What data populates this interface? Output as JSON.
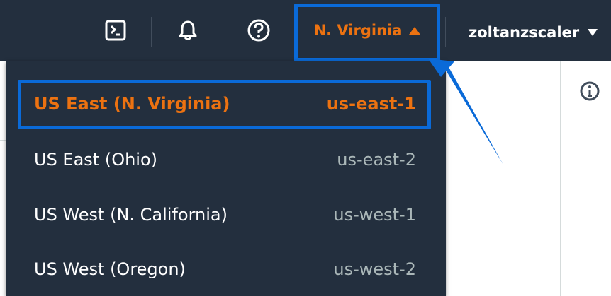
{
  "topbar": {
    "region_label": "N. Virginia",
    "user_label": "zoltanzscaler",
    "icons": [
      "cloudshell-icon",
      "bell-icon",
      "help-icon"
    ]
  },
  "region_menu": {
    "items": [
      {
        "name": "US East (N. Virginia)",
        "code": "us-east-1",
        "selected": true
      },
      {
        "name": "US East (Ohio)",
        "code": "us-east-2",
        "selected": false
      },
      {
        "name": "US West (N. California)",
        "code": "us-west-1",
        "selected": false
      },
      {
        "name": "US West (Oregon)",
        "code": "us-west-2",
        "selected": false
      }
    ]
  },
  "colors": {
    "navbar": "#232f3e",
    "accent": "#ec7211",
    "highlight": "#0a6ad8",
    "code_text": "#aab7b8"
  }
}
